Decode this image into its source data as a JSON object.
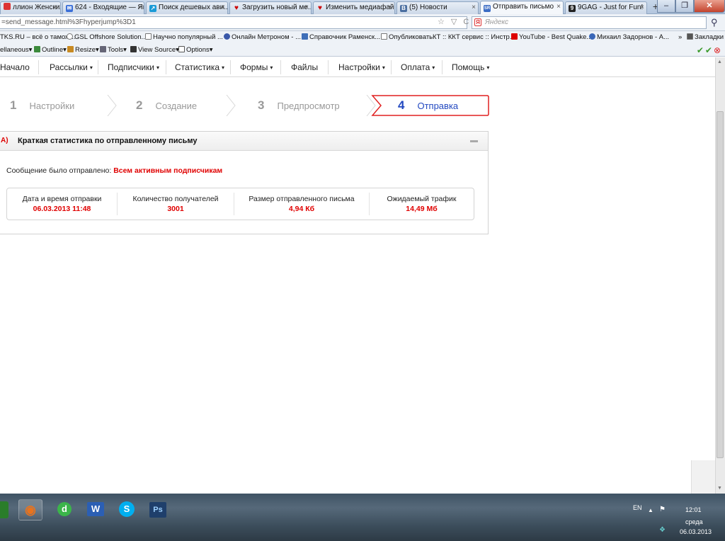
{
  "browser": {
    "tabs": [
      {
        "label": "ллион Женских Х...",
        "icon_color": "#d33",
        "icon": ""
      },
      {
        "label": "624 - Входящие — Ян...",
        "icon_color": "#3a6fd8",
        "icon": "✉"
      },
      {
        "label": "Поиск дешевых ави...",
        "icon_color": "#1a9ad6",
        "icon": "↗"
      },
      {
        "label": "Загрузить новый ме...",
        "icon_color": "#c00",
        "icon": "♥"
      },
      {
        "label": "Изменить медиафай...",
        "icon_color": "#c00",
        "icon": "♥"
      },
      {
        "label": "(5) Новости",
        "icon_color": "#4a6ea0",
        "icon": "В"
      },
      {
        "label": "Отправить письмо",
        "icon_color": "#3b6cc4",
        "icon": "SR"
      },
      {
        "label": "9GAG - Just for Fun!",
        "icon_color": "#222",
        "icon": "9"
      }
    ],
    "new_tab": "+",
    "url": "=send_message.html%3Fhyperjump%3D1",
    "search_placeholder": "Яндекс",
    "search_logo": "Я",
    "bookmarks": [
      "TKS.RU – всё о тамож...",
      "GSL Offshore Solution...",
      "Научно популярный ...",
      "Онлайн Метроном - ...",
      "Справочник Раменск...",
      "Опубликовать",
      "КТ :: ККТ сервис :: Инстр...",
      "YouTube - Best Quake...",
      "Михаил Задорнов - А...",
      "»",
      "Закладки"
    ],
    "toolbar_items": [
      "ellaneous▾",
      "Outline▾",
      "Resize▾",
      "Tools▾",
      "View Source▾",
      "Options▾"
    ]
  },
  "app": {
    "menu": [
      {
        "label": "Начало",
        "caret": ""
      },
      {
        "label": "Рассылки",
        "caret": "▾"
      },
      {
        "label": "Подписчики",
        "caret": "▾"
      },
      {
        "label": "Статистика",
        "caret": "▾"
      },
      {
        "label": "Формы",
        "caret": "▾"
      },
      {
        "label": "Файлы",
        "caret": ""
      },
      {
        "label": "Настройки",
        "caret": "▾"
      },
      {
        "label": "Оплата",
        "caret": "▾"
      },
      {
        "label": "Помощь",
        "caret": "▾"
      }
    ],
    "steps": [
      {
        "num": "1",
        "label": "Настройки"
      },
      {
        "num": "2",
        "label": "Создание"
      },
      {
        "num": "3",
        "label": "Предпросмотр"
      },
      {
        "num": "4",
        "label": "Отправка"
      }
    ],
    "active_step_color": "#e02020",
    "panel": {
      "letter": "A)",
      "title": "Краткая статистика по отправленному письму",
      "sent_prefix": "Сообщение было отправлено:",
      "sent_target": "Всем активным подписчикам",
      "stats": [
        {
          "label": "Дата и время отправки",
          "value": "06.03.2013 11:48"
        },
        {
          "label": "Количество получателей",
          "value": "3001"
        },
        {
          "label": "Размер отправленного письма",
          "value": "4,94 Кб"
        },
        {
          "label": "Ожидаемый трафик",
          "value": "14,49 Мб"
        }
      ]
    }
  },
  "taskbar": {
    "apps": [
      {
        "name": "firefox",
        "glyph": "◉",
        "color": "#e8731e"
      },
      {
        "name": "d-app",
        "glyph": "d",
        "color": "#3bb54a"
      },
      {
        "name": "word",
        "glyph": "W",
        "color": "#2b5fb4"
      },
      {
        "name": "skype",
        "glyph": "S",
        "color": "#00aff0"
      },
      {
        "name": "photoshop",
        "glyph": "Ps",
        "color": "#1f3f6b"
      }
    ],
    "lang": "EN",
    "time": "12:01",
    "day": "среда",
    "date": "06.03.2013"
  }
}
